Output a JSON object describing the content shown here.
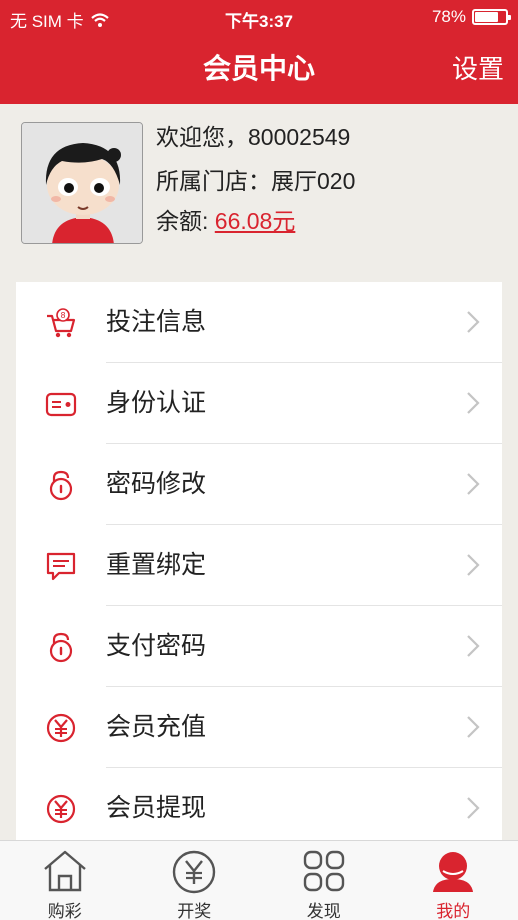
{
  "status_bar": {
    "carrier": "无 SIM 卡",
    "time": "下午3:37",
    "battery": "78%",
    "battery_level": 0.78
  },
  "nav": {
    "title": "会员中心",
    "settings_label": "设置"
  },
  "profile": {
    "welcome": "欢迎您，80002549",
    "store": "所属门店：展厅020",
    "balance_label": "余额: ",
    "balance_value": "66.08元"
  },
  "menu": {
    "items": [
      {
        "label": "投注信息",
        "icon": "cart-icon"
      },
      {
        "label": "身份认证",
        "icon": "id-card-icon"
      },
      {
        "label": "密码修改",
        "icon": "lock-icon"
      },
      {
        "label": "重置绑定",
        "icon": "message-icon"
      },
      {
        "label": "支付密码",
        "icon": "lock-icon"
      },
      {
        "label": "会员充值",
        "icon": "yuan-icon"
      },
      {
        "label": "会员提现",
        "icon": "yuan-icon"
      }
    ]
  },
  "tabbar": {
    "tabs": [
      {
        "label": "购彩",
        "icon": "home-icon"
      },
      {
        "label": "开奖",
        "icon": "yuan-circle-icon"
      },
      {
        "label": "发现",
        "icon": "grid-icon"
      },
      {
        "label": "我的",
        "icon": "user-icon",
        "active": true
      }
    ]
  },
  "colors": {
    "brand_red": "#d9242f",
    "background": "#efede8"
  }
}
